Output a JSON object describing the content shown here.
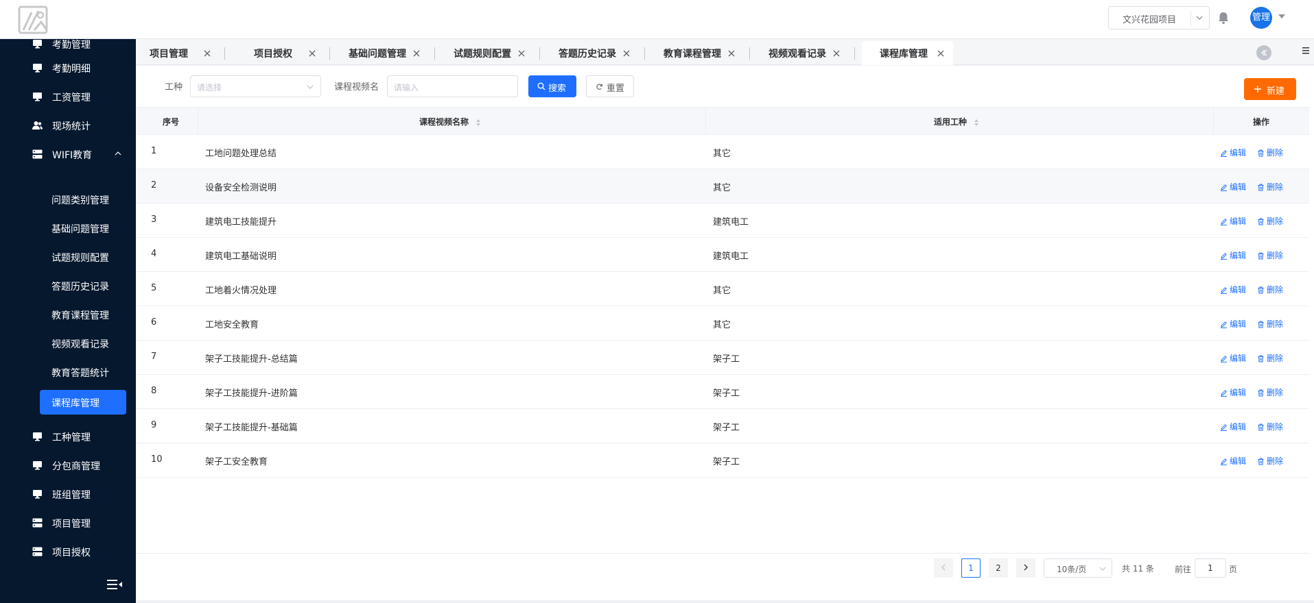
{
  "header": {
    "project_select": "文兴花园项目",
    "user_avatar": "管理"
  },
  "sidebar": {
    "items": [
      {
        "label": "考勤管理"
      },
      {
        "label": "考勤明细"
      },
      {
        "label": "工资管理"
      },
      {
        "label": "现场统计"
      },
      {
        "label": "WIFI教育"
      },
      {
        "label": "工种管理"
      },
      {
        "label": "分包商管理"
      },
      {
        "label": "班组管理"
      },
      {
        "label": "项目管理"
      },
      {
        "label": "项目授权"
      }
    ],
    "sub_items": [
      {
        "label": "问题类别管理"
      },
      {
        "label": "基础问题管理"
      },
      {
        "label": "试题规则配置"
      },
      {
        "label": "答题历史记录"
      },
      {
        "label": "教育课程管理"
      },
      {
        "label": "视频观看记录"
      },
      {
        "label": "教育答题统计"
      },
      {
        "label": "课程库管理"
      }
    ]
  },
  "tabs": [
    {
      "label": "项目管理"
    },
    {
      "label": "项目授权"
    },
    {
      "label": "基础问题管理"
    },
    {
      "label": "试题规则配置"
    },
    {
      "label": "答题历史记录"
    },
    {
      "label": "教育课程管理"
    },
    {
      "label": "视频观看记录"
    },
    {
      "label": "课程库管理"
    }
  ],
  "filters": {
    "type_label": "工种",
    "type_placeholder": "请选择",
    "name_label": "课程视频名",
    "name_placeholder": "请输入",
    "search_label": "搜索",
    "reset_label": "重置",
    "new_label": "新建"
  },
  "table": {
    "headers": [
      "序号",
      "课程视频名称",
      "适用工种",
      "操作"
    ],
    "edit_label": "编辑",
    "delete_label": "删除",
    "rows": [
      {
        "no": "1",
        "name": "工地问题处理总结",
        "type": "其它"
      },
      {
        "no": "2",
        "name": "设备安全检测说明",
        "type": "其它"
      },
      {
        "no": "3",
        "name": "建筑电工技能提升",
        "type": "建筑电工"
      },
      {
        "no": "4",
        "name": "建筑电工基础说明",
        "type": "建筑电工"
      },
      {
        "no": "5",
        "name": "工地着火情况处理",
        "type": "其它"
      },
      {
        "no": "6",
        "name": "工地安全教育",
        "type": "其它"
      },
      {
        "no": "7",
        "name": "架子工技能提升-总结篇",
        "type": "架子工"
      },
      {
        "no": "8",
        "name": "架子工技能提升-进阶篇",
        "type": "架子工"
      },
      {
        "no": "9",
        "name": "架子工技能提升-基础篇",
        "type": "架子工"
      },
      {
        "no": "10",
        "name": "架子工安全教育",
        "type": "架子工"
      }
    ]
  },
  "pagination": {
    "pages": [
      "1",
      "2"
    ],
    "current": "1",
    "page_size": "10条/页",
    "total": "共 11 条",
    "goto_prefix": "前往",
    "goto_value": "1",
    "goto_suffix": "页"
  },
  "colors": {
    "sidebar_bg": "#06182e",
    "accent": "#1e6fff",
    "new_button": "#ff6a00"
  }
}
